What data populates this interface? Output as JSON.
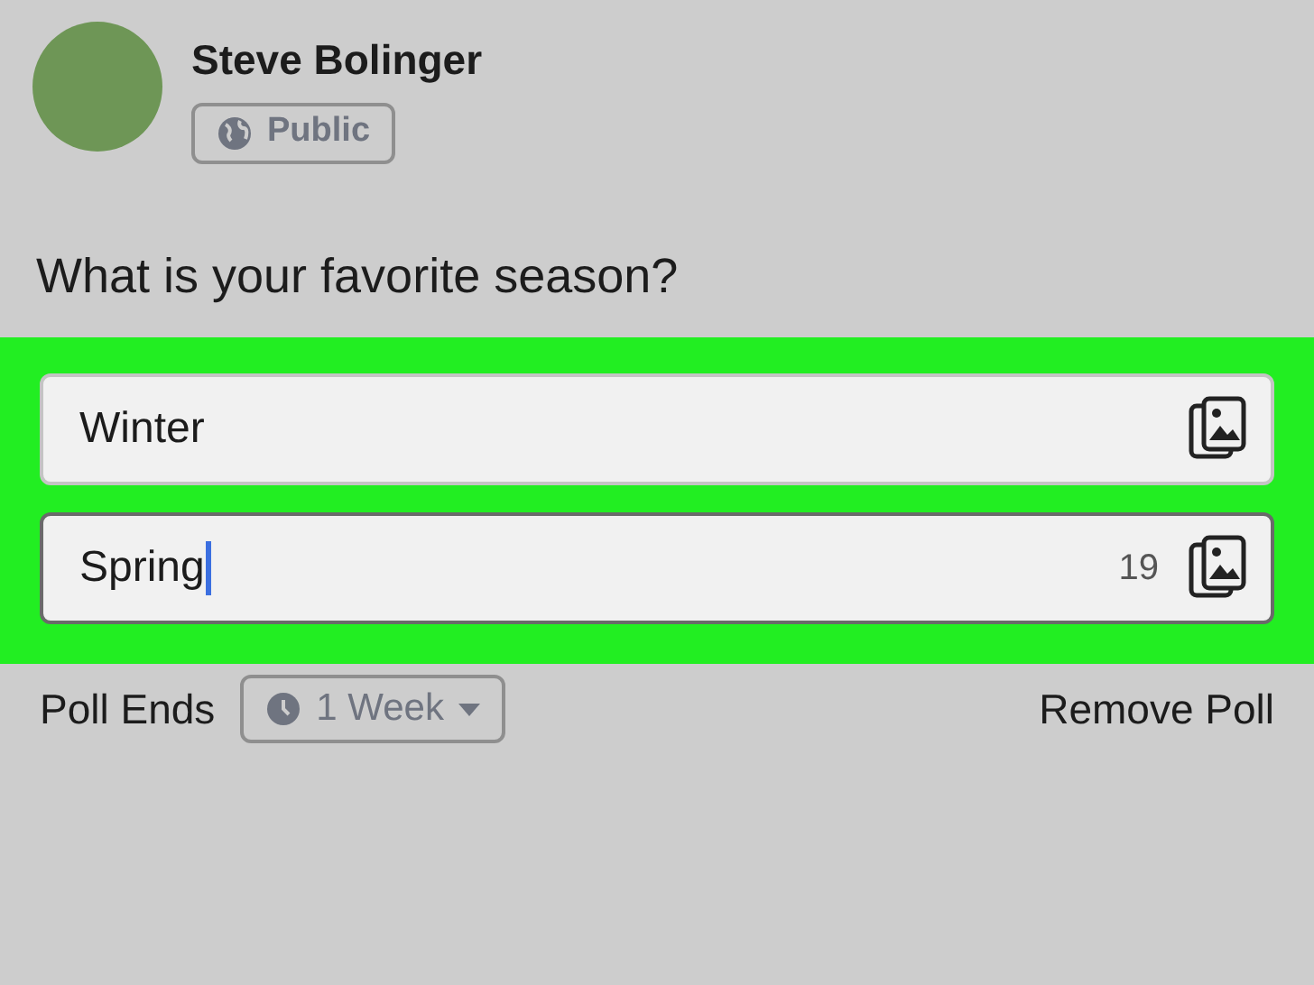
{
  "author": {
    "name": "Steve Bolinger",
    "audience": "Public"
  },
  "question": "What is your favorite season?",
  "options": [
    {
      "value": "Winter",
      "focused": false
    },
    {
      "value": "Spring",
      "focused": true,
      "counter": "19"
    }
  ],
  "poll_ends": {
    "label": "Poll Ends",
    "duration": "1 Week"
  },
  "remove": "Remove Poll"
}
